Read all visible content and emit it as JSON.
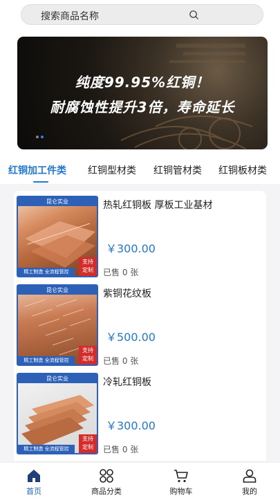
{
  "search": {
    "placeholder": "搜索商品名称"
  },
  "banner": {
    "line1": "纯度99.95%红铜！",
    "line2": "耐腐蚀性提升3倍，寿命延长",
    "slide_count": 2,
    "active_slide": 1
  },
  "categories": [
    {
      "label": "红铜加工件类",
      "active": true
    },
    {
      "label": "红铜型材类",
      "active": false
    },
    {
      "label": "红铜管材类",
      "active": false
    },
    {
      "label": "红铜板材类",
      "active": false
    }
  ],
  "products": [
    {
      "title": "热轧红铜板 厚板工业基材",
      "price": "￥300.00",
      "sold": "已售 0 张",
      "thumb": {
        "brand": "昆仑实业",
        "footer": "精工制造 全流程管控",
        "badge_1": "支持",
        "badge_2": "定制"
      }
    },
    {
      "title": "紫铜花纹板",
      "price": "￥500.00",
      "sold": "已售 0 张",
      "thumb": {
        "brand": "昆仑实业",
        "footer": "精工制造 全流程管控",
        "badge_1": "支持",
        "badge_2": "定制"
      }
    },
    {
      "title": "冷轧红铜板",
      "price": "￥300.00",
      "sold": "已售 0 张",
      "thumb": {
        "brand": "昆仑实业",
        "footer": "精工制造 全流程管控",
        "badge_1": "支持",
        "badge_2": "定制"
      }
    }
  ],
  "tabbar": [
    {
      "label": "首页",
      "icon": "home-icon",
      "active": true
    },
    {
      "label": "商品分类",
      "icon": "grid-icon",
      "active": false
    },
    {
      "label": "购物车",
      "icon": "cart-icon",
      "active": false
    },
    {
      "label": "我的",
      "icon": "user-icon",
      "active": false
    }
  ],
  "colors": {
    "accent": "#1e78d4",
    "tab_active": "#1e60b8",
    "badge": "#d42b2b",
    "thumb_frame": "#2d61b8"
  }
}
